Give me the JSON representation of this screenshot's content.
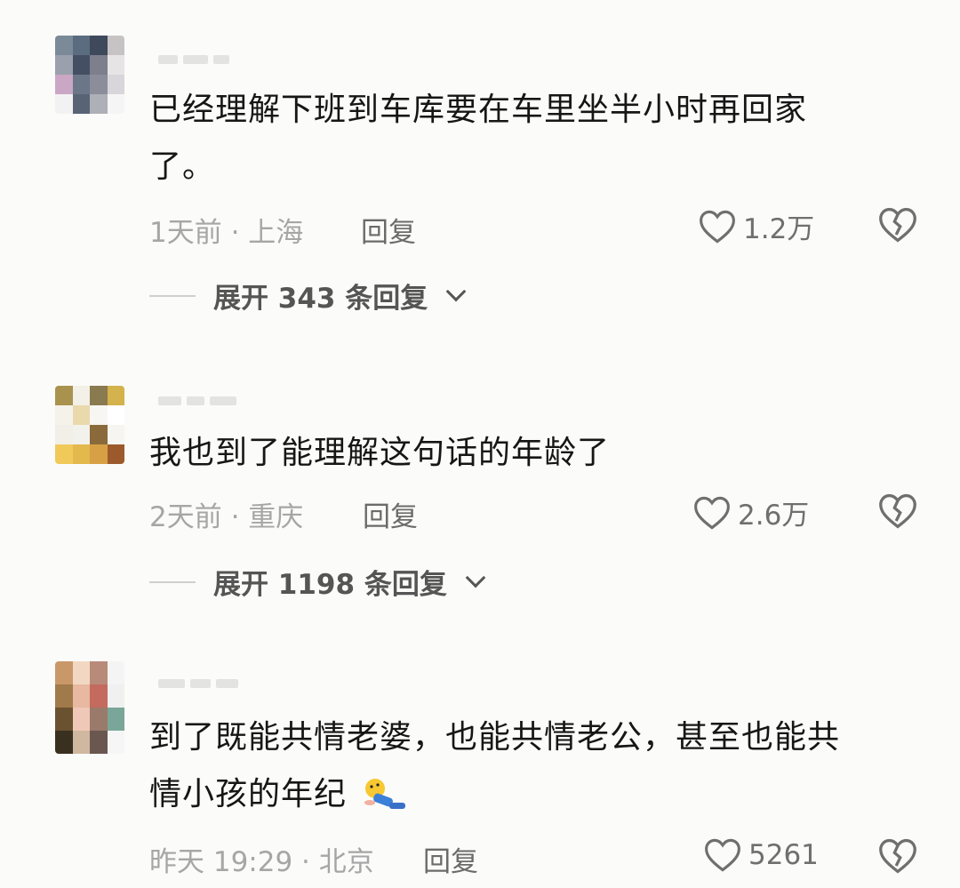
{
  "comments": [
    {
      "text_line1": "已经理解下班到车库要在车里坐半小时再回家",
      "text_line2": "了。",
      "meta": "1天前 · 上海",
      "reply_label": "回复",
      "likes": "1.2万",
      "expand_label": "展开 343 条回复"
    },
    {
      "text_line1": "我也到了能理解这句话的年龄了",
      "meta": "2天前 · 重庆",
      "reply_label": "回复",
      "likes": "2.6万",
      "expand_label": "展开 1198 条回复"
    },
    {
      "text_line1": "到了既能共情老婆，也能共情老公，甚至也能共",
      "text_line2": "情小孩的年纪",
      "meta": "昨天 19:29 · 北京",
      "reply_label": "回复",
      "likes": "5261"
    }
  ],
  "icons": {
    "like": "heart-outline-icon",
    "dislike": "broken-heart-icon",
    "expand": "chevron-down-icon",
    "emoji": "lying-down-emoji-icon"
  },
  "colors": {
    "background": "#fbfbf9",
    "text": "#161616",
    "meta": "#a6a6a6",
    "action": "#6b6b6b"
  }
}
